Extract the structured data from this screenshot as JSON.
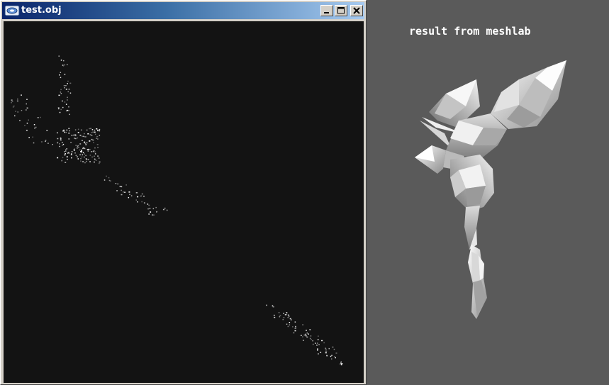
{
  "window": {
    "title": "test.obj",
    "icon": "app-window-icon",
    "controls": {
      "minimize_icon": "minimize-icon",
      "maximize_icon": "maximize-icon",
      "close_icon": "close-icon"
    }
  },
  "viewport": {
    "background": "#131313",
    "content": "point-cloud"
  },
  "right_panel": {
    "caption": "result from meshlab",
    "background": "#5a5a5a",
    "content": "shaded-mesh"
  },
  "colors": {
    "title_start": "#0a246a",
    "title_end": "#a6caf0",
    "caption": "#ffffff"
  }
}
